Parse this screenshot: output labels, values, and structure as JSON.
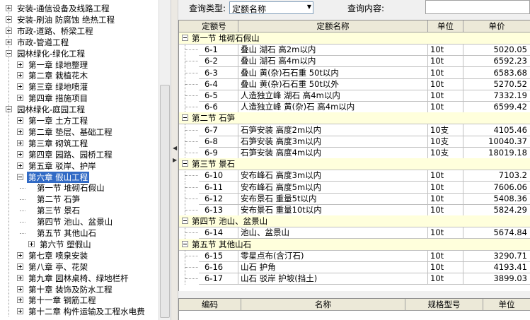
{
  "tree": {
    "items": [
      {
        "label": "安装-通信设备及线路工程",
        "level": 0,
        "expanded": false
      },
      {
        "label": "安装-刷油 防腐蚀 绝热工程",
        "level": 0,
        "expanded": false
      },
      {
        "label": "市政-道路、桥梁工程",
        "level": 0,
        "expanded": false
      },
      {
        "label": "市政-管道工程",
        "level": 0,
        "expanded": false
      },
      {
        "label": "园林绿化-绿化工程",
        "level": 0,
        "expanded": true
      },
      {
        "label": "第一章 绿地整理",
        "level": 1,
        "expanded": false
      },
      {
        "label": "第二章 栽植花木",
        "level": 1,
        "expanded": false
      },
      {
        "label": "第三章 绿地喷灌",
        "level": 1,
        "expanded": false
      },
      {
        "label": "第四章 措施项目",
        "level": 1,
        "expanded": false
      },
      {
        "label": "园林绿化-庭园工程",
        "level": 0,
        "expanded": true
      },
      {
        "label": "第一章 土方工程",
        "level": 1,
        "expanded": false
      },
      {
        "label": "第二章 垫层、基础工程",
        "level": 1,
        "expanded": false
      },
      {
        "label": "第三章 砌筑工程",
        "level": 1,
        "expanded": false
      },
      {
        "label": "第四章 园路、园桥工程",
        "level": 1,
        "expanded": false
      },
      {
        "label": "第五章 驳岸、护岸",
        "level": 1,
        "expanded": false
      },
      {
        "label": "第六章 假山工程",
        "level": 1,
        "expanded": true,
        "selected": true
      },
      {
        "label": "第一节 堆砌石假山",
        "level": 2,
        "leaf": true
      },
      {
        "label": "第二节 石笋",
        "level": 2,
        "leaf": true
      },
      {
        "label": "第三节 景石",
        "level": 2,
        "leaf": true
      },
      {
        "label": "第四节 池山、盆景山",
        "level": 2,
        "leaf": true
      },
      {
        "label": "第五节 其他山石",
        "level": 2,
        "leaf": true
      },
      {
        "label": "第六节 塑假山",
        "level": 2,
        "expanded": false
      },
      {
        "label": "第七章 喷泉安装",
        "level": 1,
        "expanded": false
      },
      {
        "label": "第八章 亭、花架",
        "level": 1,
        "expanded": false
      },
      {
        "label": "第九章 园林桌椅、绿地栏杆",
        "level": 1,
        "expanded": false
      },
      {
        "label": "第十章 装饰及防水工程",
        "level": 1,
        "expanded": false
      },
      {
        "label": "第十一章 钢筋工程",
        "level": 1,
        "expanded": false
      },
      {
        "label": "第十二章 构件运输及工程水电费",
        "level": 1,
        "expanded": false
      }
    ]
  },
  "query": {
    "type_label": "查询类型:",
    "type_value": "定额名称",
    "content_label": "查询内容:",
    "content_value": ""
  },
  "grid": {
    "columns": [
      "定额号",
      "定额名称",
      "单位",
      "单价"
    ],
    "sections": [
      {
        "title": "第一节 堆砌石假山",
        "rows": [
          {
            "code": "6-1",
            "name": "叠山 湖石 高2m以内",
            "unit": "10t",
            "price": "5020.05"
          },
          {
            "code": "6-2",
            "name": "叠山 湖石 高4m以内",
            "unit": "10t",
            "price": "6592.23"
          },
          {
            "code": "6-3",
            "name": "叠山 黄(杂)石石重 50t以内",
            "unit": "10t",
            "price": "6583.68"
          },
          {
            "code": "6-4",
            "name": "叠山 黄(杂)石石重 50t以外",
            "unit": "10t",
            "price": "5270.52"
          },
          {
            "code": "6-5",
            "name": "人造独立峰 湖石 高4m以内",
            "unit": "10t",
            "price": "7332.19"
          },
          {
            "code": "6-6",
            "name": "人造独立峰 黄(杂)石 高4m以内",
            "unit": "10t",
            "price": "6599.42"
          }
        ]
      },
      {
        "title": "第二节 石笋",
        "rows": [
          {
            "code": "6-7",
            "name": "石笋安装 高度2m以内",
            "unit": "10支",
            "price": "4105.46"
          },
          {
            "code": "6-8",
            "name": "石笋安装 高度3m以内",
            "unit": "10支",
            "price": "10040.37"
          },
          {
            "code": "6-9",
            "name": "石笋安装 高度4m以内",
            "unit": "10支",
            "price": "18019.18"
          }
        ]
      },
      {
        "title": "第三节 景石",
        "rows": [
          {
            "code": "6-10",
            "name": "安布峰石 高度3m以内",
            "unit": "10t",
            "price": "7103.2"
          },
          {
            "code": "6-11",
            "name": "安布峰石 高度5m以内",
            "unit": "10t",
            "price": "7606.06"
          },
          {
            "code": "6-12",
            "name": "安布景石 重量5t以内",
            "unit": "10t",
            "price": "5408.36"
          },
          {
            "code": "6-13",
            "name": "安布景石 重量10t以内",
            "unit": "10t",
            "price": "5824.29"
          }
        ]
      },
      {
        "title": "第四节 池山、盆景山",
        "rows": [
          {
            "code": "6-14",
            "name": "池山、盆景山",
            "unit": "10t",
            "price": "5674.84"
          }
        ]
      },
      {
        "title": "第五节 其他山石",
        "rows": [
          {
            "code": "6-15",
            "name": "零星点布(含汀石)",
            "unit": "10t",
            "price": "3290.71"
          },
          {
            "code": "6-16",
            "name": "山石 护角",
            "unit": "10t",
            "price": "4193.41"
          },
          {
            "code": "6-17",
            "name": "山石 驳岸 护坡(挡土)",
            "unit": "10t",
            "price": "3899.03"
          }
        ]
      }
    ]
  },
  "grid2": {
    "columns": [
      "编码",
      "名称",
      "规格型号",
      "单位"
    ]
  }
}
